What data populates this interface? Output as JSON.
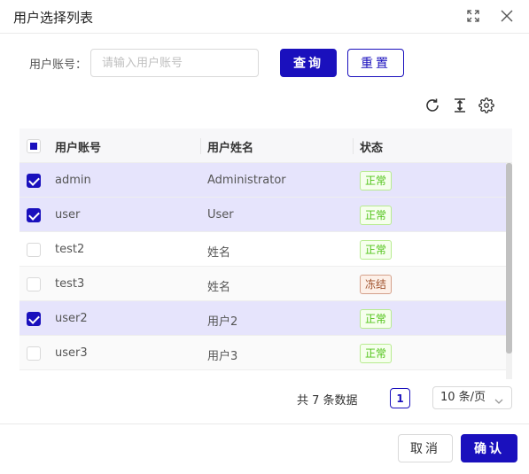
{
  "dialog": {
    "title": "用户选择列表",
    "maximize_icon": "expand-icon",
    "close_icon": "close-icon"
  },
  "search": {
    "label": "用户账号：",
    "placeholder": "请输入用户账号",
    "value": "",
    "query_button": "查询",
    "reset_button": "重置"
  },
  "toolbar": {
    "icons": [
      "refresh-icon",
      "column-height-icon",
      "settings-icon"
    ]
  },
  "table": {
    "columns": [
      "用户账号",
      "用户姓名",
      "状态"
    ],
    "header_checkbox": "partial",
    "rows": [
      {
        "account": "admin",
        "name": "Administrator",
        "status": "正常",
        "selected": true
      },
      {
        "account": "user",
        "name": "User",
        "status": "正常",
        "selected": true
      },
      {
        "account": "test2",
        "name": "姓名",
        "status": "正常",
        "selected": false
      },
      {
        "account": "test3",
        "name": "姓名",
        "status": "冻结",
        "selected": false
      },
      {
        "account": "user2",
        "name": "用户2",
        "status": "正常",
        "selected": true
      },
      {
        "account": "user3",
        "name": "用户3",
        "status": "正常",
        "selected": false
      }
    ]
  },
  "pagination": {
    "total_text": "共 7 条数据",
    "current_page": "1",
    "page_size": "10 条/页"
  },
  "footer": {
    "cancel_button": "取消",
    "confirm_button": "确认"
  },
  "colors": {
    "primary": "#1a10bd",
    "selected_row": "#e6e4fc",
    "status_normal": "#52c41a",
    "status_frozen": "#a0522d"
  }
}
